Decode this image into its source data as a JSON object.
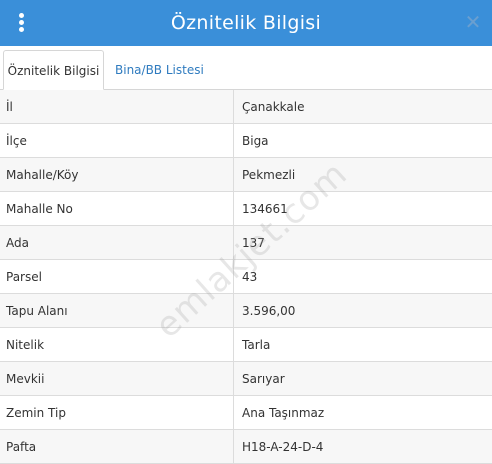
{
  "dialog": {
    "title": "Öznitelik Bilgisi",
    "close_glyph": "✕"
  },
  "tabs": [
    {
      "label": "Öznitelik Bilgisi",
      "active": true
    },
    {
      "label": "Bina/BB Listesi",
      "active": false
    }
  ],
  "rows": [
    {
      "key": "İl",
      "value": "Çanakkale"
    },
    {
      "key": "İlçe",
      "value": "Biga"
    },
    {
      "key": "Mahalle/Köy",
      "value": "Pekmezli"
    },
    {
      "key": "Mahalle No",
      "value": "134661"
    },
    {
      "key": "Ada",
      "value": "137"
    },
    {
      "key": "Parsel",
      "value": "43"
    },
    {
      "key": "Tapu Alanı",
      "value": "3.596,00"
    },
    {
      "key": "Nitelik",
      "value": "Tarla"
    },
    {
      "key": "Mevkii",
      "value": "Sarıyar"
    },
    {
      "key": "Zemin Tip",
      "value": "Ana Taşınmaz"
    },
    {
      "key": "Pafta",
      "value": "H18-A-24-D-4"
    }
  ],
  "watermark": "emlakjet.com",
  "colors": {
    "header": "#3a8fd9",
    "tab_link": "#2f7bbf"
  }
}
